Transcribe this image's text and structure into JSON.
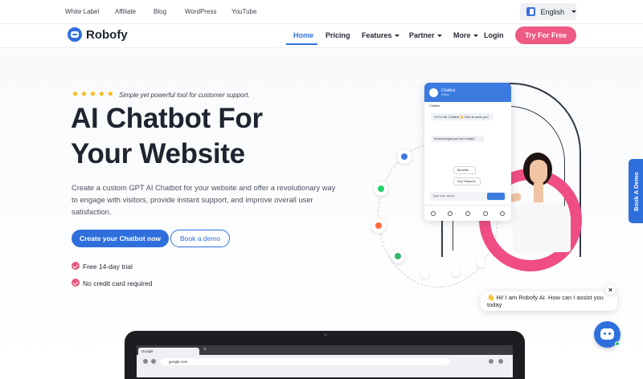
{
  "topbar": {
    "links": [
      "White Label",
      "Affiliate",
      "Blog",
      "WordPress",
      "YouTube"
    ],
    "language": "English"
  },
  "nav": {
    "brand": "Robofy",
    "items": [
      "Home",
      "Pricing",
      "Features",
      "Partner",
      "More",
      "Login"
    ],
    "active": "Home",
    "cta": "Try For Free"
  },
  "hero": {
    "rating_stars": 5,
    "tagline": "Simple yet powerful tool for customer support.",
    "title_line1": "AI Chatbot For",
    "title_line2": "Your Website",
    "description": "Create a custom GPT AI Chatbot for your website and offer a revolutionary way to engage with visitors, provide instant support, and improve overall user satisfaction.",
    "primary_button": "Create your Chatbot now",
    "secondary_button": "Book a demo",
    "checks": [
      "Free 14-day trial",
      "No credit card required"
    ]
  },
  "chat_preview": {
    "title": "Chatbot",
    "status": "Online",
    "sender": "Chatbot",
    "messages": [
      "Hi! I'm Mr. Chatbot 👋 Nice to meet you!",
      "What brought you here today?",
      "Benefits",
      "Key Features"
    ],
    "input_placeholder": "Type your query..."
  },
  "side_tab": "Book A Demo",
  "popup": {
    "message": "👋 Hi! I am Robofy AI. How can I assist you today",
    "close": "×"
  },
  "browser": {
    "tab": "Google",
    "url": "google.com"
  },
  "colors": {
    "brand_blue": "#2f6fdc",
    "accent_pink": "#ee5a84",
    "star": "#f4b400"
  }
}
